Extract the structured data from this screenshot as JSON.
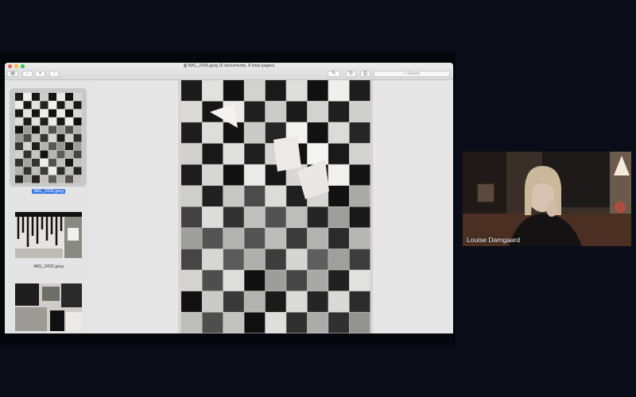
{
  "window": {
    "title": "IMG_2426.jpeg (6 documents, 8 total pages)",
    "search_placeholder": "Search"
  },
  "sidebar": {
    "items": [
      {
        "label": "IMG_2426.jpeg",
        "selected": true
      },
      {
        "label": "IMG_2432.jpeg",
        "selected": false
      },
      {
        "label": "",
        "selected": false
      }
    ]
  },
  "video": {
    "participant_name": "Louise Damgaard"
  },
  "colors": {
    "background": "#0a0d17",
    "selection": "#3574e3"
  },
  "icons": [
    "sidebar-toggle-icon",
    "zoom-out-icon",
    "zoom-in-icon",
    "share-icon",
    "markup-icon",
    "rotate-icon",
    "print-icon",
    "search-icon"
  ]
}
